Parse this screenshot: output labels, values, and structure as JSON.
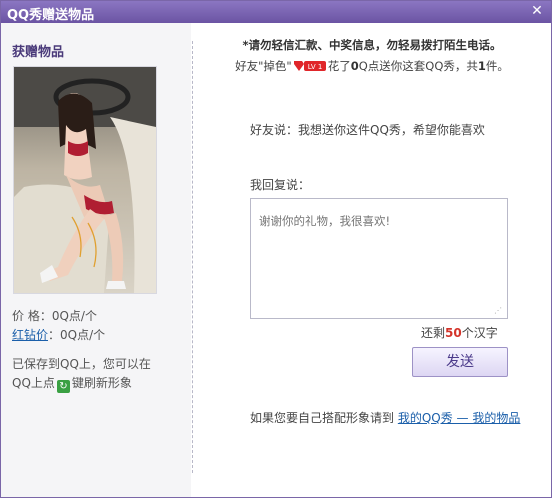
{
  "window": {
    "title": "QQ秀赠送物品",
    "close_icon": "close-icon"
  },
  "left": {
    "heading": "获赠物品",
    "price_label": "价 格：",
    "price_value": "0Q点/个",
    "red_diamond_link": "红钻价",
    "red_diamond_value": "：0Q点/个",
    "saved_text_1": "已保存到QQ上，您可以在",
    "saved_text_2a": "QQ上点",
    "saved_text_2b": "键刷新形象",
    "refresh_icon": "refresh-icon"
  },
  "right": {
    "warning": "*请勿轻信汇款、中奖信息，勿轻易拨打陌生电话。",
    "friend_prefix": "好友\"掉色\"",
    "level_badge": "LV 1",
    "friend_mid1": "花了",
    "friend_q": "0",
    "friend_mid2": "Q点送你这套QQ秀，共",
    "friend_count": "1",
    "friend_suffix": "件。",
    "friend_says": "好友说：我想送你这件QQ秀，希望你能喜欢",
    "reply_label": "我回复说：",
    "reply_placeholder": "谢谢你的礼物，我很喜欢!",
    "counter_prefix": "还剩",
    "counter_number": "50",
    "counter_suffix": "个汉字",
    "send_button": "发送",
    "footer_text": "如果您要自己搭配形象请到 ",
    "footer_link": "我的QQ秀 — 我的物品"
  },
  "colors": {
    "titlebar": "#7a63b6",
    "link": "#1b5faa",
    "counter_number": "#d4342a",
    "badge": "#e0262a"
  }
}
